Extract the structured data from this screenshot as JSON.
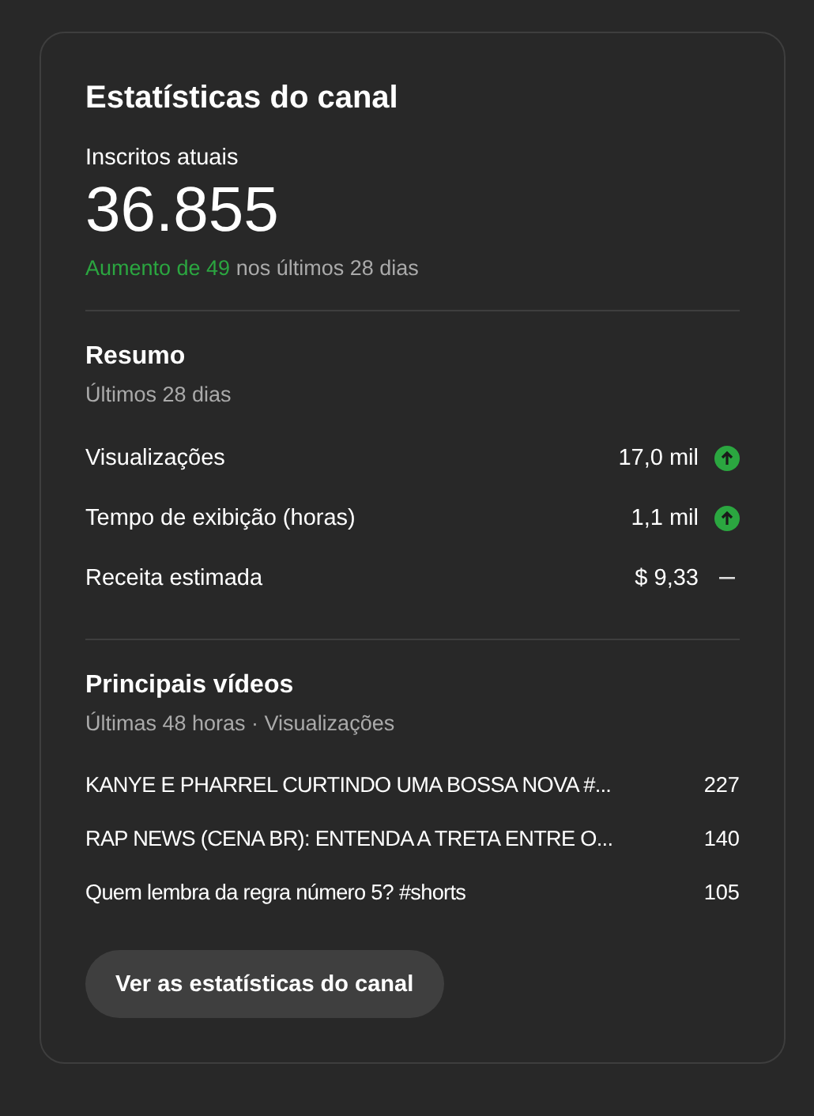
{
  "card": {
    "title": "Estatísticas do canal",
    "subscribers": {
      "label": "Inscritos atuais",
      "value": "36.855",
      "change_highlight": "Aumento de 49",
      "change_rest": "nos últimos 28 dias"
    },
    "summary": {
      "title": "Resumo",
      "subtitle": "Últimos 28 dias",
      "metrics": [
        {
          "label": "Visualizações",
          "value": "17,0 mil",
          "kind": "up"
        },
        {
          "label": "Tempo de exibição (horas)",
          "value": "1,1 mil",
          "kind": "up"
        },
        {
          "label": "Receita estimada",
          "value": "$ 9,33",
          "kind": "flat"
        }
      ]
    },
    "top_videos": {
      "title": "Principais vídeos",
      "subtitle": "Últimas 48 horas · Visualizações",
      "videos": [
        {
          "title": "KANYE E PHARREL CURTINDO UMA BOSSA NOVA #...",
          "views": "227"
        },
        {
          "title": "RAP NEWS (CENA BR): ENTENDA A TRETA ENTRE O...",
          "views": "140"
        },
        {
          "title": "Quem lembra da regra número 5? #shorts",
          "views": "105"
        }
      ]
    },
    "button": "Ver as estatísticas do canal"
  }
}
